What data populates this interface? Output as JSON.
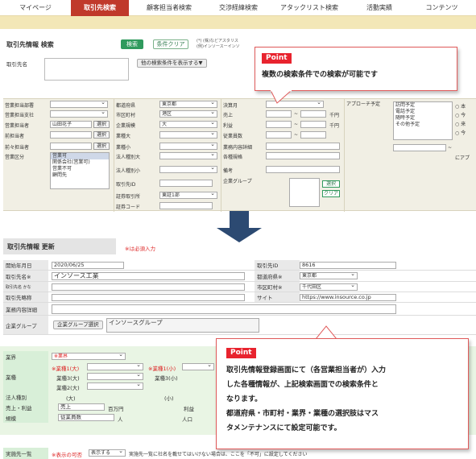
{
  "nav": {
    "tabs": [
      {
        "label": "マイページ",
        "active": false
      },
      {
        "label": "取引先検索",
        "active": true
      },
      {
        "label": "顧客担当者検索",
        "active": false
      },
      {
        "label": "交渉経緯検索",
        "active": false
      },
      {
        "label": "アタックリスト検索",
        "active": false
      },
      {
        "label": "活動実績",
        "active": false
      },
      {
        "label": "コンテンツ",
        "active": false
      }
    ]
  },
  "search": {
    "title": "取引先情報 検索",
    "search_button": "検索",
    "clear_button": "条件クリア",
    "note_line1": "(*) (株)などアスタリス",
    "note_line2": "(例)インソースーインソ",
    "client_name_label": "取引先名",
    "more_conditions_button": "他の検索条件を表示する▼"
  },
  "grid": {
    "col1_labels": [
      "営業担当部署",
      "営業担当支社",
      "営業担当者",
      "前担当者",
      "前々担当者",
      "営業区分"
    ],
    "staff_value": "山田花子",
    "select_label": "選択",
    "category_items": [
      "営業可",
      "関係会社(営業可)",
      "営業不可",
      "顧問先"
    ],
    "col2_labels": [
      "都道府県",
      "市区町村",
      "企業規模",
      "業種大",
      "業種小",
      "法人種別大",
      "法人種別小",
      "取引先ID",
      "証券取引所",
      "証券コード"
    ],
    "prefecture_value": "東京都",
    "city_value": "港区",
    "size_value": "大",
    "exchange_value": "東証1部",
    "col3_labels": [
      "決算月",
      "売上",
      "利益",
      "従業員数",
      "業務内容詳細",
      "各種規格",
      "備考",
      "企業グループ"
    ],
    "tilde": "~",
    "unit_yen": "千円",
    "select_small_button": "選択",
    "clear_small_button": "クリア",
    "approach_label": "アプローチ予定",
    "approach_items": [
      "訪問予定",
      "電話予定",
      "随時予定",
      "その他予定"
    ],
    "radio_items": [
      "本",
      "今",
      "来",
      "今"
    ],
    "date_hint": "にアプ"
  },
  "callout1": {
    "badge": "Point",
    "text": "複数の検索条件での検索が可能です"
  },
  "update": {
    "title": "取引先情報 更新",
    "required_note": "※は必須入力",
    "start_label": "開始年月日",
    "start_value": "2020/06/25",
    "name_label": "取引先名※",
    "name_value": "インソース工業",
    "kana_label": "取引先名 かな",
    "abbr_label": "取引先略称",
    "detail_label": "業務内容詳細",
    "id_label": "取引先ID",
    "id_value": "8616",
    "pref_label": "都道府県※",
    "pref_value": "東京都",
    "city_label": "市区町村※",
    "city_value": "千代田区",
    "site_label": "サイト",
    "site_value": "https://www.insource.co.jp",
    "group_label": "企業グループ",
    "group_button": "企業グループ選択",
    "group_value": "インソースグループ",
    "industry_label": "業界",
    "industry_value": "※業界",
    "sector_label": "業種",
    "sector_large1": "※業種1(大)",
    "sector_large3": "業種3(大)",
    "sector_large2": "業種2(大)",
    "sector_small1": "※業種1(小)",
    "sector_small3": "業種3(小)",
    "corp_type_label": "法人種別",
    "corp_large": "(大)",
    "corp_small": "(小)",
    "sales_label": "売上・利益",
    "sales_value": "売上",
    "unit_million": "百万円",
    "profit_value": "利益",
    "scale_label": "規模",
    "employees_value": "従業員数",
    "persons": "人",
    "capital_value": "人口",
    "list_label": "実施先一覧",
    "list_note": "※表示の可否",
    "list_select": "表示する",
    "list_desc": "実施先一覧に社名を載せてはいけない場合は、ここを「不可」に設定してください"
  },
  "callout2": {
    "badge": "Point",
    "text_lines": [
      "取引先情報登録画面にて（各営業担当者が）入力",
      "した各種情報が、上記検索画面での検索条件と",
      "なります。",
      "都道府県・市町村・業界・業種の選択肢はマス",
      "タメンテナンスにて設定可能です。"
    ]
  }
}
